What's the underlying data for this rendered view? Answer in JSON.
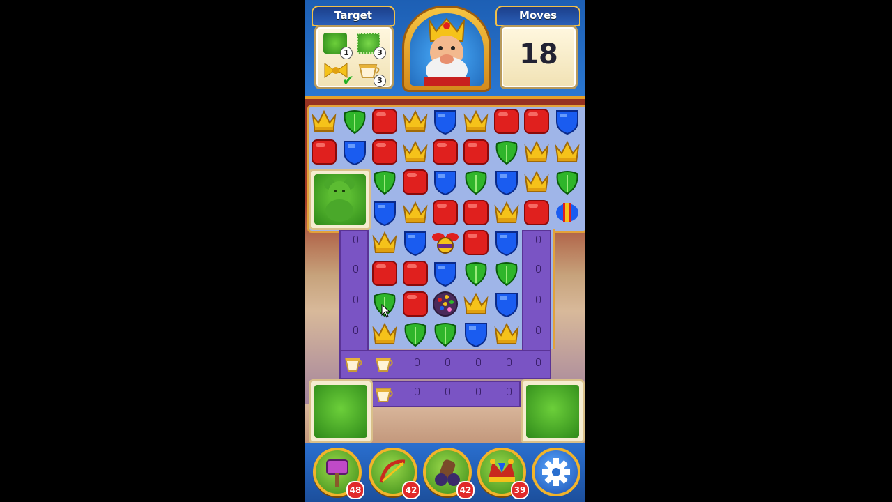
{
  "header": {
    "target_label": "Target",
    "moves_label": "Moves",
    "moves_value": "18",
    "targets": [
      {
        "name": "hedge-bear-target",
        "count": "1",
        "done": false
      },
      {
        "name": "hedge-flower-target",
        "count": "3",
        "done": false
      },
      {
        "name": "bow-target",
        "count": "",
        "done": true
      },
      {
        "name": "teacup-target",
        "count": "3",
        "done": false
      }
    ]
  },
  "board": {
    "grid": [
      [
        "crown",
        "leaf",
        "red",
        "crown",
        "shield",
        "crown",
        "red",
        "red",
        "shield"
      ],
      [
        "red",
        "shield",
        "red",
        "crown",
        "red",
        "red",
        "leaf",
        "crown",
        "crown"
      ],
      [
        "",
        "",
        "leaf",
        "red",
        "shield",
        "leaf",
        "shield",
        "crown",
        "leaf"
      ],
      [
        "",
        "",
        "shield",
        "crown",
        "red",
        "red",
        "crown",
        "red",
        "rocket"
      ],
      [
        "",
        "",
        "crown",
        "shield",
        "propeller",
        "red",
        "shield",
        "",
        ""
      ],
      [
        "",
        "",
        "red",
        "red",
        "shield",
        "leaf",
        "leaf",
        "",
        ""
      ],
      [
        "",
        "",
        "leaf",
        "red",
        "lightball",
        "crown",
        "shield",
        "",
        ""
      ],
      [
        "",
        "",
        "crown",
        "leaf",
        "leaf",
        "shield",
        "crown",
        "",
        ""
      ]
    ]
  },
  "boosters": [
    {
      "name": "royal-hammer-booster",
      "count": "48"
    },
    {
      "name": "arrow-booster",
      "count": "42"
    },
    {
      "name": "cannon-booster",
      "count": "42"
    },
    {
      "name": "jester-hat-booster",
      "count": "39"
    }
  ],
  "colors": {
    "red": "#e0201e",
    "shield": "#1a5cf0",
    "leaf": "#2fb52a",
    "crown": "#f5c21a",
    "accent": "#f2b42a"
  }
}
